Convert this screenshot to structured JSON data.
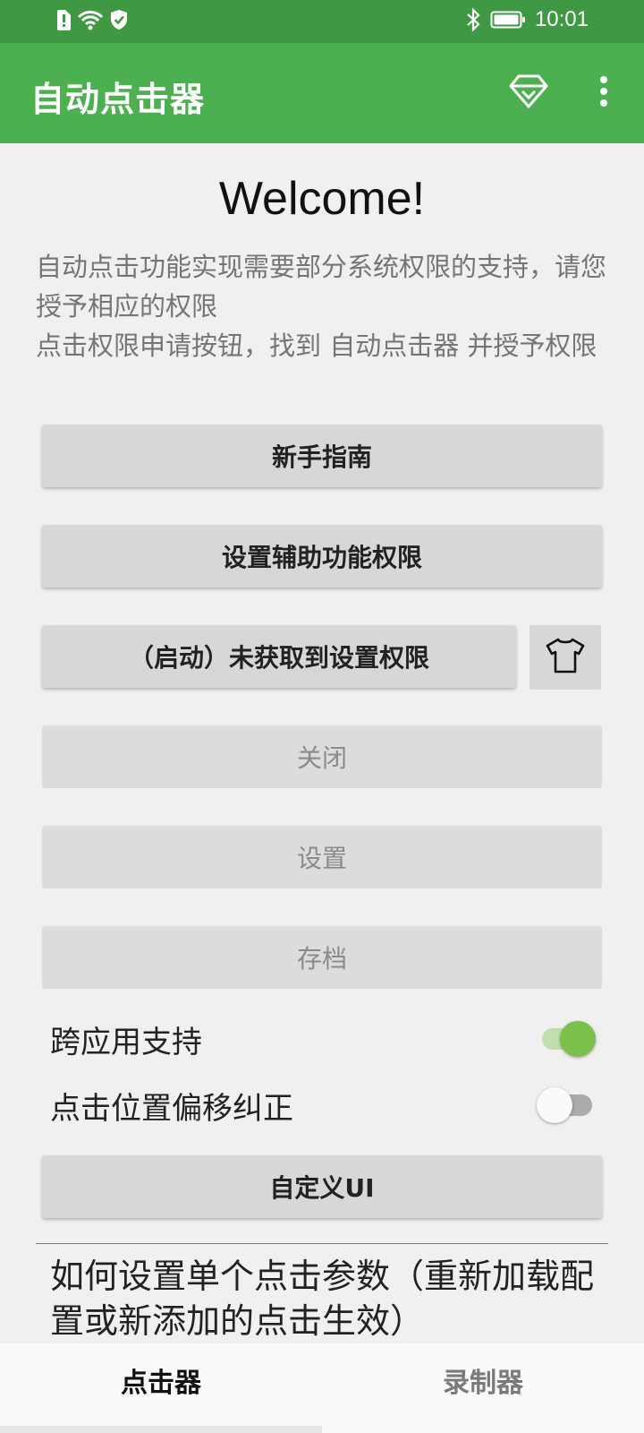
{
  "status_bar": {
    "time": "10:01",
    "icons": [
      "sim-alert-icon",
      "wifi-icon",
      "shield-icon",
      "bluetooth-icon",
      "battery-icon"
    ]
  },
  "app_bar": {
    "title": "自动点击器",
    "actions": [
      "diamond-icon",
      "more-vert-icon"
    ]
  },
  "main": {
    "welcome": "Welcome!",
    "intro_lines": [
      "自动点击功能实现需要部分系统权限的支持，请您授予相应的权限",
      "点击权限申请按钮，找到 自动点击器 并授予权限"
    ],
    "buttons": {
      "guide": "新手指南",
      "accessibility": "设置辅助功能权限",
      "start": "（启动）未获取到设置权限",
      "close": "关闭",
      "settings": "设置",
      "archive": "存档",
      "custom_ui": "自定义UI"
    },
    "switches": [
      {
        "label": "跨应用支持",
        "on": true
      },
      {
        "label": "点击位置偏移纠正",
        "on": false
      }
    ],
    "howto_text": "如何设置单个点击参数（重新加载配置或新添加的点击生效）"
  },
  "bottom_nav": {
    "tabs": [
      {
        "label": "点击器",
        "active": true
      },
      {
        "label": "录制器",
        "active": false
      }
    ]
  },
  "colors": {
    "status_bar": "#3f9843",
    "app_bar": "#4caf50",
    "switch_on": "#7bc04a",
    "background": "#f0f0f0"
  }
}
